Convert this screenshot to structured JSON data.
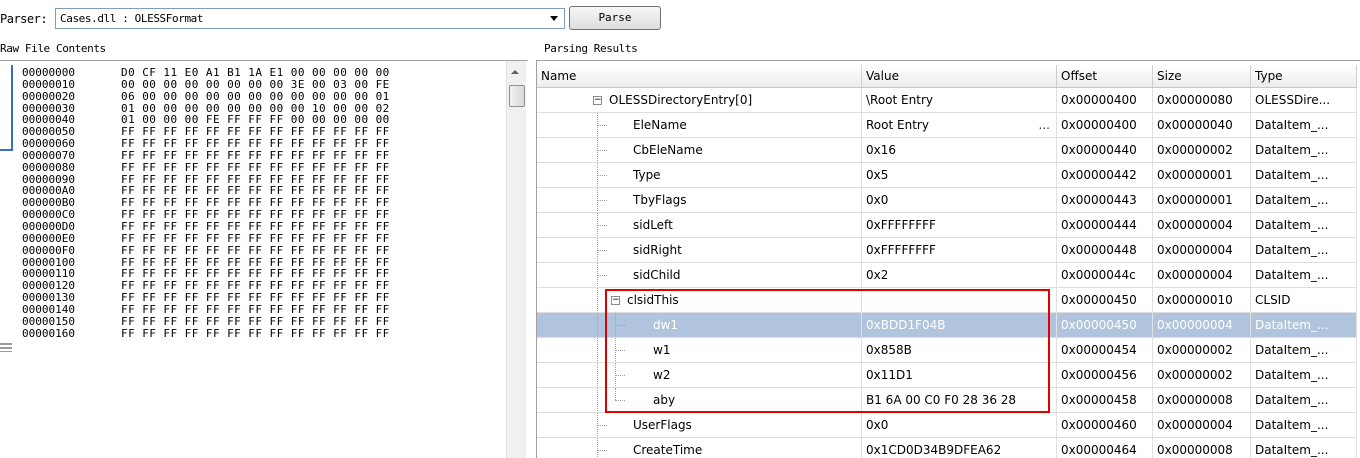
{
  "parser": {
    "label": "Parser:",
    "selected": "Cases.dll : OLESSFormat",
    "parse_button": "Parse"
  },
  "sections": {
    "raw": "Raw File Contents",
    "results": "Parsing Results"
  },
  "hex": {
    "rows": [
      {
        "addr": "00000000",
        "bytes": "D0 CF 11 E0 A1 B1 1A E1 00 00 00 00 00"
      },
      {
        "addr": "00000010",
        "bytes": "00 00 00 00 00 00 00 00 3E 00 03 00 FE"
      },
      {
        "addr": "00000020",
        "bytes": "06 00 00 00 00 00 00 00 00 00 00 00 01"
      },
      {
        "addr": "00000030",
        "bytes": "01 00 00 00 00 00 00 00 00 10 00 00 02"
      },
      {
        "addr": "00000040",
        "bytes": "01 00 00 00 FE FF FF FF 00 00 00 00 00"
      },
      {
        "addr": "00000050",
        "bytes": "FF FF FF FF FF FF FF FF FF FF FF FF FF"
      },
      {
        "addr": "00000060",
        "bytes": "FF FF FF FF FF FF FF FF FF FF FF FF FF"
      },
      {
        "addr": "00000070",
        "bytes": "FF FF FF FF FF FF FF FF FF FF FF FF FF"
      },
      {
        "addr": "00000080",
        "bytes": "FF FF FF FF FF FF FF FF FF FF FF FF FF"
      },
      {
        "addr": "00000090",
        "bytes": "FF FF FF FF FF FF FF FF FF FF FF FF FF"
      },
      {
        "addr": "000000A0",
        "bytes": "FF FF FF FF FF FF FF FF FF FF FF FF FF"
      },
      {
        "addr": "000000B0",
        "bytes": "FF FF FF FF FF FF FF FF FF FF FF FF FF"
      },
      {
        "addr": "000000C0",
        "bytes": "FF FF FF FF FF FF FF FF FF FF FF FF FF"
      },
      {
        "addr": "000000D0",
        "bytes": "FF FF FF FF FF FF FF FF FF FF FF FF FF"
      },
      {
        "addr": "000000E0",
        "bytes": "FF FF FF FF FF FF FF FF FF FF FF FF FF"
      },
      {
        "addr": "000000F0",
        "bytes": "FF FF FF FF FF FF FF FF FF FF FF FF FF"
      },
      {
        "addr": "00000100",
        "bytes": "FF FF FF FF FF FF FF FF FF FF FF FF FF"
      },
      {
        "addr": "00000110",
        "bytes": "FF FF FF FF FF FF FF FF FF FF FF FF FF"
      },
      {
        "addr": "00000120",
        "bytes": "FF FF FF FF FF FF FF FF FF FF FF FF FF"
      },
      {
        "addr": "00000130",
        "bytes": "FF FF FF FF FF FF FF FF FF FF FF FF FF"
      },
      {
        "addr": "00000140",
        "bytes": "FF FF FF FF FF FF FF FF FF FF FF FF FF"
      },
      {
        "addr": "00000150",
        "bytes": "FF FF FF FF FF FF FF FF FF FF FF FF FF"
      },
      {
        "addr": "00000160",
        "bytes": "FF FF FF FF FF FF FF FF FF FF FF FF FF"
      }
    ]
  },
  "grid": {
    "columns": {
      "name": "Name",
      "value": "Value",
      "offset": "Offset",
      "size": "Size",
      "type": "Type"
    },
    "rows": [
      {
        "name": "OLESSDirectoryEntry[0]",
        "value": "\\Root Entry",
        "offset": "0x00000400",
        "size": "0x00000080",
        "type": "OLESSDire..."
      },
      {
        "name": "EleName",
        "value": "Root Entry",
        "offset": "0x00000400",
        "size": "0x00000040",
        "type": "DataItem_...",
        "ellipsis": "..."
      },
      {
        "name": "CbEleName",
        "value": "0x16",
        "offset": "0x00000440",
        "size": "0x00000002",
        "type": "DataItem_..."
      },
      {
        "name": "Type",
        "value": "0x5",
        "offset": "0x00000442",
        "size": "0x00000001",
        "type": "DataItem_..."
      },
      {
        "name": "TbyFlags",
        "value": "0x0",
        "offset": "0x00000443",
        "size": "0x00000001",
        "type": "DataItem_..."
      },
      {
        "name": "sidLeft",
        "value": "0xFFFFFFFF",
        "offset": "0x00000444",
        "size": "0x00000004",
        "type": "DataItem_..."
      },
      {
        "name": "sidRight",
        "value": "0xFFFFFFFF",
        "offset": "0x00000448",
        "size": "0x00000004",
        "type": "DataItem_..."
      },
      {
        "name": "sidChild",
        "value": "0x2",
        "offset": "0x0000044c",
        "size": "0x00000004",
        "type": "DataItem_..."
      },
      {
        "name": "clsidThis",
        "value": "",
        "offset": "0x00000450",
        "size": "0x00000010",
        "type": "CLSID"
      },
      {
        "name": "dw1",
        "value": "0xBDD1F04B",
        "offset": "0x00000450",
        "size": "0x00000004",
        "type": "DataItem_..."
      },
      {
        "name": "w1",
        "value": "0x858B",
        "offset": "0x00000454",
        "size": "0x00000002",
        "type": "DataItem_..."
      },
      {
        "name": "w2",
        "value": "0x11D1",
        "offset": "0x00000456",
        "size": "0x00000002",
        "type": "DataItem_..."
      },
      {
        "name": "aby",
        "value": "B1 6A 00 C0 F0 28 36 28",
        "offset": "0x00000458",
        "size": "0x00000008",
        "type": "DataItem_..."
      },
      {
        "name": "UserFlags",
        "value": "0x0",
        "offset": "0x00000460",
        "size": "0x00000004",
        "type": "DataItem_..."
      },
      {
        "name": "CreateTime",
        "value": "0x1CD0D34B9DFEA62",
        "offset": "0x00000464",
        "size": "0x00000008",
        "type": "DataItem_..."
      }
    ]
  },
  "colors": {
    "selection": "#b0c4de",
    "highlight_border": "#e00000"
  }
}
